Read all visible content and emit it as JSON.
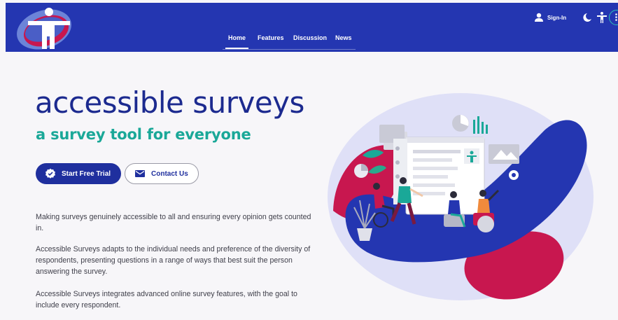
{
  "header": {
    "background_color": "#2436b1",
    "logo_icon": "accessibility-figure-logo",
    "nav": [
      {
        "label": "Home",
        "active": true
      },
      {
        "label": "Features",
        "active": false
      },
      {
        "label": "Discussion",
        "active": false
      },
      {
        "label": "News",
        "active": false
      }
    ],
    "signin_label": "Sign-In",
    "toolbar_icons": [
      "person-icon",
      "theme-toggle-icon",
      "accessibility-icon",
      "more-vert-icon"
    ]
  },
  "hero": {
    "title": "accessible surveys",
    "subtitle": "a survey tool for everyone",
    "title_color": "#1c2a8f",
    "subtitle_color": "#1aa898",
    "buttons": {
      "primary_label": "Start Free Trial",
      "primary_icon": "verified-badge-icon",
      "secondary_label": "Contact Us",
      "secondary_icon": "mail-icon"
    },
    "paragraphs": [
      "Making surveys genuinely accessible to all and ensuring every opinion gets counted in.",
      "Accessible Surveys adapts to the individual needs and preference of the diversity of respondents, presenting questions in a range of ways that best suit the person answering the survey.",
      "Accessible Surveys integrates advanced online survey features, with the goal to include every respondent."
    ]
  },
  "illustration": {
    "description_icon": "people-survey-illustration",
    "colors": {
      "blob": "#dfe0f7",
      "blue": "#2436b1",
      "crimson": "#c8174f",
      "teal": "#1aa898"
    }
  }
}
